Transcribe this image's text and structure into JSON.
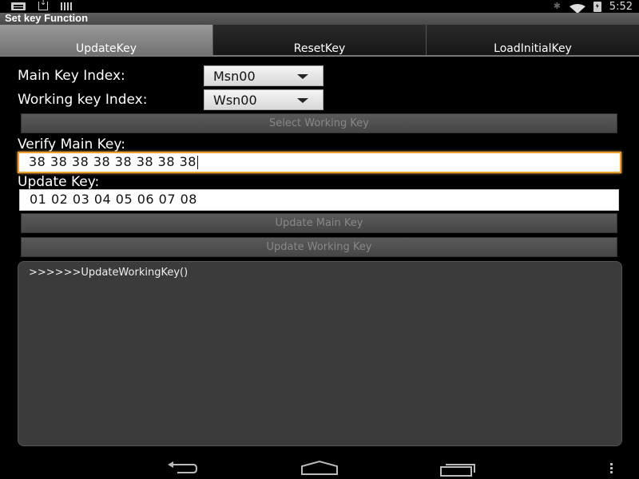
{
  "status_bar": {
    "left_icons": [
      "message-icon",
      "download-icon",
      "barcode-icon"
    ],
    "right_icons": [
      "bluetooth-icon",
      "wifi-icon",
      "battery-icon"
    ],
    "time": "5:52"
  },
  "app": {
    "title": "Set key Function"
  },
  "tabs": [
    {
      "label": "UpdateKey",
      "active": true
    },
    {
      "label": "ResetKey",
      "active": false
    },
    {
      "label": "LoadInitialKey",
      "active": false
    }
  ],
  "form": {
    "main_key_index_label": "Main Key Index:",
    "main_key_index_value": "Msn00",
    "working_key_index_label": "Working key Index:",
    "working_key_index_value": "Wsn00",
    "select_working_key_button": "Select Working Key",
    "verify_main_key_label": "Verify Main Key:",
    "verify_main_key_value": "38 38 38 38 38 38 38 38",
    "update_key_label": "Update Key:",
    "update_key_value": "01 02 03 04 05 06 07 08",
    "update_main_key_button": "Update Main Key",
    "update_working_key_button": "Update Working Key"
  },
  "log": {
    "text": ">>>>>>UpdateWorkingKey()"
  },
  "nav_bar": {
    "icons": [
      "back-icon",
      "home-icon",
      "recent-apps-icon",
      "menu-icon"
    ]
  },
  "colors": {
    "focus_border": "#f0a030",
    "active_tab": "#8a8a8a",
    "log_background": "#3b3b3b"
  }
}
